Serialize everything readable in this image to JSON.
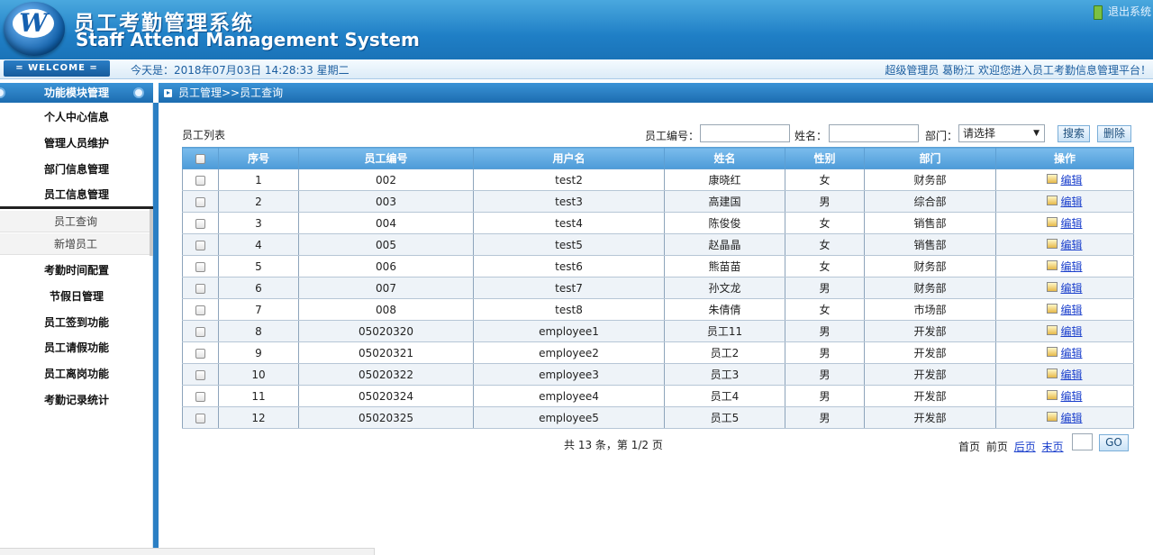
{
  "header": {
    "logo_letter": "W",
    "title_cn": "员工考勤管理系统",
    "title_en": "Staff Attend Management System",
    "logout_label": "退出系统"
  },
  "infobar": {
    "welcome_label": "= WELCOME =",
    "datetime": "今天是：2018年07月03日   14:28:33   星期二",
    "greeting": "超级管理员   葛盼江  欢迎您进入员工考勤信息管理平台！"
  },
  "sidebar": {
    "header": "功能模块管理",
    "items_top": [
      "个人中心信息",
      "管理人员维护",
      "部门信息管理",
      "员工信息管理"
    ],
    "sub_items": [
      "员工查询",
      "新增员工"
    ],
    "items_bottom": [
      "考勤时间配置",
      "节假日管理",
      "员工签到功能",
      "员工请假功能",
      "员工离岗功能",
      "考勤记录统计"
    ]
  },
  "breadcrumb": "员工管理>>员工查询",
  "search": {
    "list_title": "员工列表",
    "emp_no_label": "员工编号：",
    "name_label": "姓名：",
    "dept_label": "部门：",
    "dept_selected": "请选择",
    "search_button": "搜索",
    "delete_button": "删除"
  },
  "table": {
    "columns": [
      "",
      "序号",
      "员工编号",
      "用户名",
      "姓名",
      "性别",
      "部门",
      "操作"
    ],
    "edit_label": "编辑",
    "rows": [
      [
        "1",
        "002",
        "test2",
        "康晓红",
        "女",
        "财务部"
      ],
      [
        "2",
        "003",
        "test3",
        "高建国",
        "男",
        "综合部"
      ],
      [
        "3",
        "004",
        "test4",
        "陈俊俊",
        "女",
        "销售部"
      ],
      [
        "4",
        "005",
        "test5",
        "赵晶晶",
        "女",
        "销售部"
      ],
      [
        "5",
        "006",
        "test6",
        "熊苗苗",
        "女",
        "财务部"
      ],
      [
        "6",
        "007",
        "test7",
        "孙文龙",
        "男",
        "财务部"
      ],
      [
        "7",
        "008",
        "test8",
        "朱倩倩",
        "女",
        "市场部"
      ],
      [
        "8",
        "05020320",
        "employee1",
        "员工11",
        "男",
        "开发部"
      ],
      [
        "9",
        "05020321",
        "employee2",
        "员工2",
        "男",
        "开发部"
      ],
      [
        "10",
        "05020322",
        "employee3",
        "员工3",
        "男",
        "开发部"
      ],
      [
        "11",
        "05020324",
        "employee4",
        "员工4",
        "男",
        "开发部"
      ],
      [
        "12",
        "05020325",
        "employee5",
        "员工5",
        "男",
        "开发部"
      ]
    ]
  },
  "pager": {
    "info": "共 13 条，第 1/2 页",
    "first": "首页",
    "prev": "前页",
    "next": "后页",
    "last": "末页",
    "go": "GO"
  }
}
